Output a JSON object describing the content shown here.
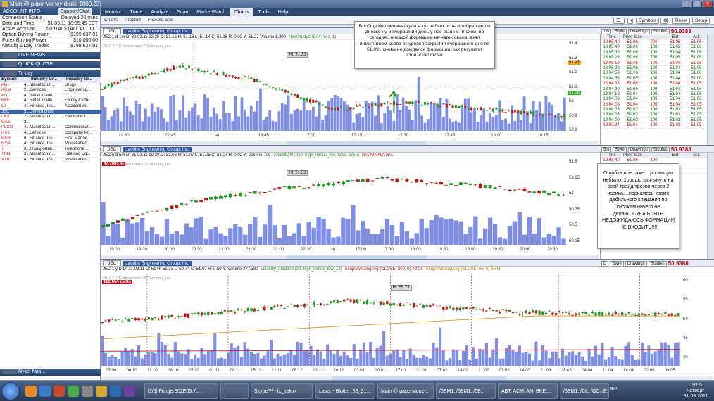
{
  "window": {
    "title": "Main @ paperMoney (build 1800.23)"
  },
  "left": {
    "account_info": "ACCOUNT INFO",
    "support_btn": "Support/Chat",
    "rows": [
      {
        "label": "Connection Status",
        "value": "Delayed 20 mins"
      },
      {
        "label": "Date and Time",
        "value": "31.03.11 18:05:45 EET"
      },
      {
        "label": "Active Account",
        "value": "<TOTAL> (ALL ACCO..."
      },
      {
        "label": "Option Buying Power",
        "value": "$199,637.01"
      },
      {
        "label": "Forex Buying Power",
        "value": "$10,000.00"
      },
      {
        "label": "Net Liq & Day Trades",
        "value": "$199,637.01"
      }
    ],
    "live_news": "LIVE NEWS",
    "quick_quote": "QUICK QUOTE",
    "today": "To day",
    "wl_header": [
      "Symbol",
      "",
      "Industry Gr...",
      "Industry Gr..."
    ],
    "watchlist": [
      {
        "sym": "ABT",
        "n": "4...",
        "ig": "Manufacturi...",
        "ig2": "Drugs"
      },
      {
        "sym": "ACM",
        "n": "2...",
        "ig": "Services",
        "ig2": "Engineering..."
      },
      {
        "sym": "AN",
        "n": "4...",
        "ig": "Retail Trade",
        "ig2": ""
      },
      {
        "sym": "BKE",
        "n": "4...",
        "ig": "Retail Trade",
        "ig2": "Family Clothi..."
      },
      {
        "sym": "CI",
        "n": "4...",
        "ig": "Finance, Ins...",
        "ig2": "Accident wi..."
      },
      {
        "sym": "JEC",
        "n": "5...",
        "ig": "Construction",
        "ig2": ""
      },
      {
        "sym": "LKS",
        "n": "2...",
        "ig": "Manufacturi...",
        "ig2": "Electronic C..."
      },
      {
        "sym": "OAS",
        "n": "3...",
        "ig": "",
        "ig2": ""
      },
      {
        "sym": "PLCM",
        "n": "4...",
        "ig": "Manufacturi...",
        "ig2": "Communicat..."
      },
      {
        "sym": "RHT",
        "n": "4...",
        "ig": "Services",
        "ig2": "Computer Pr..."
      },
      {
        "sym": "RNR",
        "n": "6...",
        "ig": "Finance, Ins...",
        "ig2": "Fire, Marine,..."
      },
      {
        "sym": "RYN",
        "n": "4...",
        "ig": "Finance, Ins...",
        "ig2": "Miscellaneo..."
      },
      {
        "sym": "T",
        "n": "3...",
        "ig": "Transportati...",
        "ig2": "Telephone ..."
      },
      {
        "sym": "TRN",
        "n": "3...",
        "ig": "Manufacturi...",
        "ig2": "Railroad Eq..."
      },
      {
        "sym": "VTR",
        "n": "4...",
        "ig": "Finance, Ins...",
        "ig2": "Miscellaneo..."
      }
    ],
    "bottom_widget": "Nyse_Nas..."
  },
  "tabs": [
    "Monitor",
    "Trade",
    "Analyze",
    "Scan",
    "MarketWatch",
    "Charts",
    "Tools",
    "Help"
  ],
  "active_tab": "Charts",
  "subtabs": [
    "Charts",
    "Prophet",
    "Flexible Grid"
  ],
  "toolbar": {
    "symbols": "Symbols",
    "reset": "Reset",
    "setup": "Setup"
  },
  "panes": [
    {
      "sym": "JEC",
      "co": "Jacobs Engineering Group, Inc.",
      "info": "JEC 1 d 1m  D: 30.03.11 22:35  O: 51.15  H: 51.16  L: 51.14  C: 51.16  R: 0.02  Y:  51.27  Volume  1,309",
      "study": "NewStudy0 (DAY, Yes, 1)",
      "copyright": "2010 © TD Ameritrade IP Company, Inc.",
      "hi": "Hi: 51.33",
      "agg": "1m",
      "price": "50.9388",
      "times": [
        "22:30",
        "22:45",
        "Чт",
        "18:45",
        "17:00",
        "17:15",
        "17:30",
        "17:45",
        "18:00",
        "18:15"
      ],
      "yt": [
        "51.4",
        "51.3",
        "51.2",
        "51.1",
        "51",
        "50.9",
        "50.8"
      ],
      "ylim": [
        50.8,
        51.42
      ],
      "badge1": "51.27",
      "badge2": "51.06"
    },
    {
      "sym": "JEC",
      "co": "Jacobs Engineering Group, Inc.",
      "info": "JEC 5 d 5m  D: 31.03.11 19:30  O: 51.06  H: 51.07  L: 51.05  C: 51.07  R: 0.02  Y:  Volume  700",
      "study": "volatility001 (30, high_minus_low, false, false)",
      "extra": "N/A  N/A  N/A  N/A",
      "pct": "47.7605 %",
      "copyright": "2010 © TD Ameritrade IP Company, Inc.",
      "hi": "Hi: 51.33",
      "agg": "5m",
      "price": "50.9388",
      "times": [
        "19:00",
        "19:30",
        "20:00",
        "20:30",
        "21:00",
        "21:30",
        "22:00",
        "22:30",
        "Чт",
        "17:00",
        "17:30",
        "18:00",
        "18:30",
        "19:00",
        "19:30",
        "20:00",
        "20:30"
      ],
      "yt": [
        "51.5",
        "51.25",
        "51",
        "50.75",
        "50.5",
        "50.25"
      ],
      "ylim": [
        50.2,
        51.55
      ]
    },
    {
      "sym": "JEC",
      "co": "Jacobs Engineering Group, Inc.",
      "info": "JEC 1 y D  D: 31.03.11  O: 51  H: 51.33  L: 50.74  C: 51.07  R: 0.59  Y:  Volume  377,380",
      "study": "volatility_mod000 (30, high_minus_low_13)",
      "sma1": "SimpleMovingAvg (CLOSE, 200, 0)",
      "sma1v": "42.28",
      "sma2": "SimpleMovingAvg (CLOSE, 50, 0)",
      "sma2v": "50.59",
      "cents": "122.654 cents",
      "copyright": "2010 © TD Ameritrade IP Company, Inc.",
      "hi": "Hi: 55.73",
      "agg": "D",
      "price": "50.9388",
      "times": [
        "27.09",
        "04.10",
        "11.10",
        "18.10",
        "25.10",
        "01.11",
        "08.11",
        "15.11",
        "22.11",
        "06.12",
        "13.12",
        "20.12",
        "03.01",
        "10.01",
        "17.01",
        "31.01",
        "07.02",
        "14.02",
        "21.02",
        "07.03",
        "14.03",
        "21.03",
        "28.03",
        "04.04",
        "11.04",
        "18.04",
        "02.05",
        "09.05"
      ],
      "yt": [
        "60",
        "55",
        "50",
        "45",
        "40"
      ],
      "ylim": [
        38,
        62
      ]
    }
  ],
  "note1": "Вообще не понимаю хули я тут забыл, хоть и тобрал ее по дневке ну и вчерашний день у нее был не плохой, но сегодня...никакой формации не нарисовала..взял пимитнином снова от уровня закрытия вчерашнего дня по 51,09...снова не дождался формации..как результат стоп..стоп стоял",
  "note2": "Ошибка все таже...формации небыло..хорошо взяпянуть на свой трейд трезво через 2 часика....поркамесь кроме дебильного клацания по кнопкам ничего не делаю...СУКА БЛЯТЬ НЕДОЖИДАЮСЬ ФОРМАЦИИ НЕ ВХОДИТЬ!!!!",
  "ts_headers": [
    "Time",
    "Price Size",
    "",
    "Bid",
    "Ask"
  ],
  "ts1": [
    [
      "18:05:40",
      "51.06",
      "200",
      "51.05",
      "51.06"
    ],
    [
      "18:05:40",
      "51.06",
      "100",
      "51.05",
      "51.06"
    ],
    [
      "18:05:39",
      "51.06",
      "100",
      "51.04",
      "51.06"
    ],
    [
      "18:05:23",
      "51.06",
      "200",
      "51.05",
      "51.06"
    ],
    [
      "18:05:19",
      "51.06",
      "100",
      "51.04",
      "51.06"
    ],
    [
      "18:05:02",
      "51.06",
      "100",
      "51.04",
      "51.06"
    ],
    [
      "18:04:59",
      "51.06",
      "100",
      "51.04",
      "51.06"
    ],
    [
      "18:04:53",
      "51.05",
      "100",
      "51.04",
      "51.06"
    ],
    [
      "18:04:33",
      "51.06",
      "100",
      "51.04",
      "51.05"
    ],
    [
      "18:04:30",
      "51.05",
      "100",
      "51.04",
      "51.06"
    ],
    [
      "18:04:18",
      "51.04",
      "100",
      "51.04",
      "51.06"
    ],
    [
      "18:04:06",
      "51.04",
      "100",
      "51.04",
      "51.06"
    ],
    [
      "18:04:06",
      "51.04",
      "100",
      "51.04",
      "51.05"
    ],
    [
      "18:04:03",
      "51.03",
      "100",
      "51.03",
      "51.05"
    ],
    [
      "18:04:03",
      "51.03",
      "100",
      "51.03",
      "51.05"
    ],
    [
      "18:04:00",
      "51.03",
      "100",
      "51.03",
      "51.05"
    ],
    [
      "18:03:34",
      "51.04",
      "100",
      "51.03",
      "51.05"
    ]
  ],
  "ts2": [
    [
      "19:05:40",
      "51.06",
      "100"
    ],
    [
      "19:05:40",
      "51.06",
      "200"
    ],
    [
      "19:05:39",
      "51.06",
      "100"
    ]
  ],
  "taskbar": {
    "items": [
      "[2/5] Fringe.S02E03.7...",
      "",
      "Skype™ - fx_sektor",
      "Laser - Blotter: 88_31...",
      "Main @ paperMone...",
      "/6BM1, /6BM1, /6B...",
      "ABT, ACM, AN, BKE,...",
      "/6EM1, /CL, /GC, /E..."
    ],
    "lang": "RU",
    "time": "19:05",
    "day": "четверг",
    "date": "31.03.2011"
  }
}
